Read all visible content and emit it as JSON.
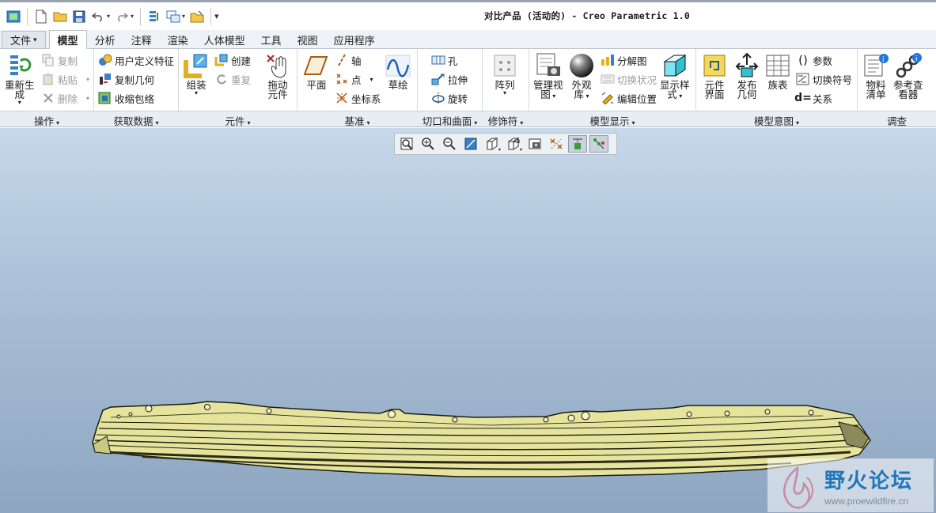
{
  "window": {
    "title": "对比产品 (活动的) - Creo Parametric 1.0"
  },
  "tabs": [
    {
      "label": "文件",
      "suffix": "▾"
    },
    {
      "label": "模型"
    },
    {
      "label": "分析"
    },
    {
      "label": "注释"
    },
    {
      "label": "渲染"
    },
    {
      "label": "人体模型"
    },
    {
      "label": "工具"
    },
    {
      "label": "视图"
    },
    {
      "label": "应用程序"
    }
  ],
  "groups": {
    "operations": {
      "label": "操作",
      "regen_l1": "重新生",
      "regen_l2": "成",
      "copy": "复制",
      "paste": "粘贴",
      "delete": "删除"
    },
    "get_data": {
      "label": "获取数据",
      "udf": "用户定义特征",
      "copy_geom": "复制几何",
      "shrinkwrap": "收缩包络"
    },
    "component": {
      "label": "元件",
      "assemble": "组装",
      "create": "创建",
      "repeat": "重复",
      "drag_l1": "拖动",
      "drag_l2": "元件"
    },
    "datum": {
      "label": "基准",
      "plane": "平面",
      "axis": "轴",
      "point": "点",
      "csys": "坐标系",
      "sketch": "草绘"
    },
    "cut_surface": {
      "label": "切口和曲面",
      "hole": "孔",
      "extrude": "拉伸",
      "revolve": "旋转"
    },
    "modifiers": {
      "label": "修饰符",
      "pattern": "阵列"
    },
    "model_display": {
      "label": "模型显示",
      "mgr_l1": "管理视",
      "mgr_l2": "图",
      "appear_l1": "外观",
      "appear_l2": "库",
      "explode": "分解图",
      "toggle_state": "切换状况",
      "edit_pos": "编辑位置",
      "disp_l1": "显示样",
      "disp_l2": "式"
    },
    "model_intent": {
      "label": "模型意图",
      "comp_l1": "元件",
      "comp_l2": "界面",
      "pub_l1": "发布",
      "pub_l2": "几何",
      "family": "族表",
      "params": "参数",
      "switch_sym": "切换符号",
      "relations": "关系"
    },
    "investigate": {
      "label": "调查",
      "bom_l1": "物料",
      "bom_l2": "清单",
      "ref_l1": "参考查",
      "ref_l2": "看器"
    }
  },
  "watermark": {
    "text": "野火论坛",
    "url": "www.proewildfire.cn"
  },
  "colors": {
    "accent": "#1f77b9",
    "model_fill": "#e6e4a0",
    "model_edge": "#1c1c10"
  }
}
